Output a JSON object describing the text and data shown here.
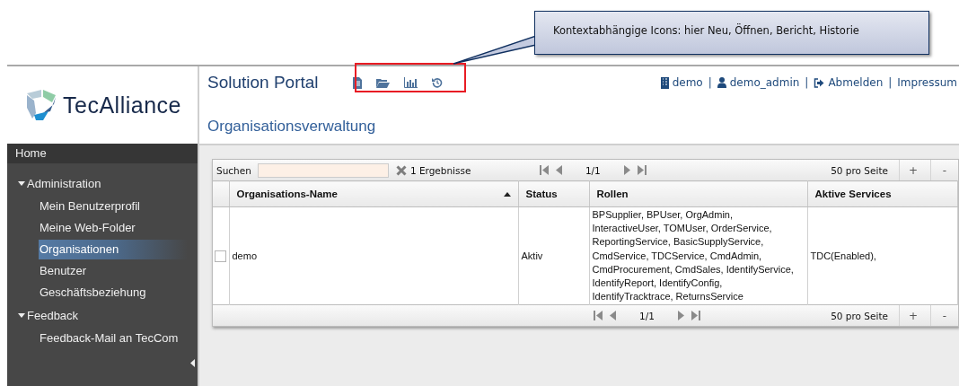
{
  "callout": {
    "text": "Kontextabhängige Icons: hier Neu, Öffnen, Bericht, Historie"
  },
  "logo": {
    "text": "TecAlliance"
  },
  "header": {
    "title": "Solution Portal",
    "user_links": [
      {
        "kind": "company",
        "label": "demo"
      },
      {
        "kind": "separator",
        "label": "|"
      },
      {
        "kind": "user",
        "label": "demo_admin"
      },
      {
        "kind": "separator",
        "label": "|"
      },
      {
        "kind": "logout",
        "label": "Abmelden"
      },
      {
        "kind": "separator",
        "label": "|"
      },
      {
        "kind": "plain",
        "label": "Impressum"
      }
    ]
  },
  "page_title": "Organisationsverwaltung",
  "sidebar": {
    "items": [
      {
        "kind": "home",
        "label": "Home"
      },
      {
        "kind": "group",
        "label": "Administration",
        "expanded": true,
        "children": [
          {
            "label": "Mein Benutzerprofil",
            "selected": false
          },
          {
            "label": "Meine Web-Folder",
            "selected": false
          },
          {
            "label": "Organisationen",
            "selected": true
          },
          {
            "label": "Benutzer",
            "selected": false
          },
          {
            "label": "Geschäftsbeziehung",
            "selected": false
          }
        ]
      },
      {
        "kind": "group",
        "label": "Feedback",
        "expanded": true,
        "children": [
          {
            "label": "Feedback-Mail an TecCom",
            "selected": false
          }
        ]
      }
    ]
  },
  "table": {
    "search": {
      "label": "Suchen"
    },
    "result_count": "1 Ergebnisse",
    "pagers": [
      {
        "page": "1/1",
        "per_page": "50 pro Seite",
        "add": "+",
        "remove": "-"
      },
      {
        "page": "1/1",
        "per_page": "50 pro Seite",
        "add": "+",
        "remove": "-"
      }
    ],
    "columns": [
      {
        "label": "Organisations-Name",
        "sorted_ascending": true
      },
      {
        "label": "Status",
        "sorted_ascending": false
      },
      {
        "label": "Rollen",
        "sorted_ascending": false
      },
      {
        "label": "Aktive Services",
        "sorted_ascending": false
      }
    ],
    "rows": [
      {
        "selected": false,
        "cells": [
          "demo",
          "Aktiv",
          "BPSupplier, BPUser, OrgAdmin, InteractiveUser, TOMUser, OrderService, ReportingService, BasicSupplyService, CmdService, TDCService, CmdAdmin, CmdProcurement, CmdSales, IdentifyService, IdentifyReport, IdentifyConfig, IdentifyTracktrace, ReturnsService",
          "TDC(Enabled),"
        ]
      }
    ]
  }
}
